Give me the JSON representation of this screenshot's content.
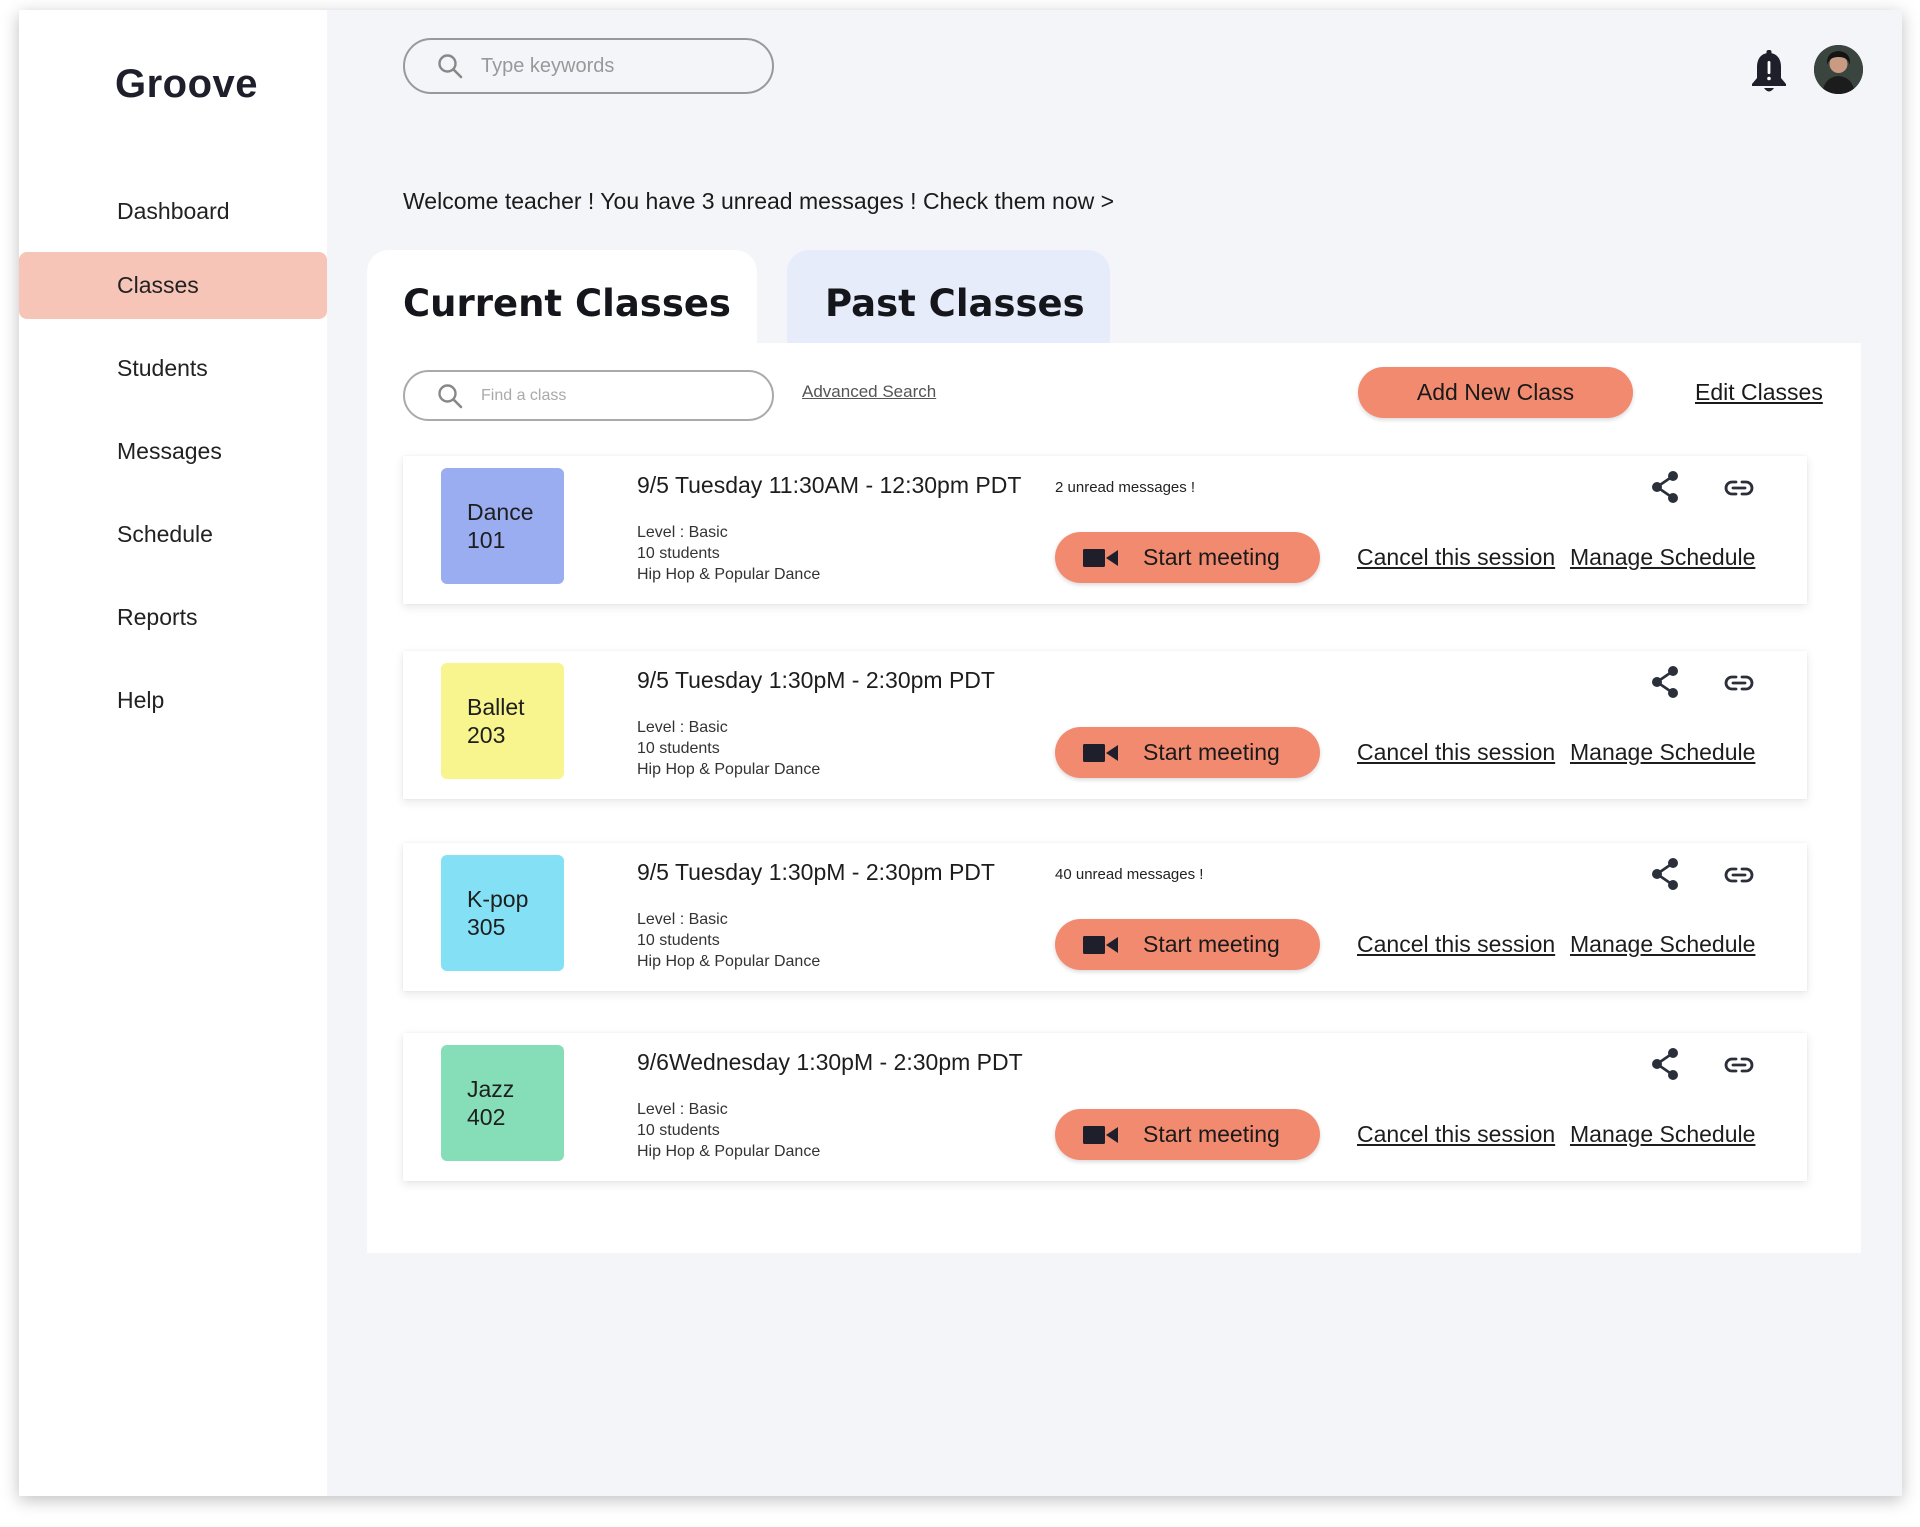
{
  "app": {
    "logo": "Groove"
  },
  "sidebar": {
    "items": [
      {
        "label": "Dashboard"
      },
      {
        "label": "Classes"
      },
      {
        "label": "Students"
      },
      {
        "label": "Messages"
      },
      {
        "label": "Schedule"
      },
      {
        "label": "Reports"
      },
      {
        "label": "Help"
      }
    ],
    "active": "Classes"
  },
  "header": {
    "search_placeholder": "Type keywords",
    "bell_icon": "bell-icon",
    "avatar": "user-avatar"
  },
  "welcome": "Welcome teacher ! You have 3 unread messages ! Check them now >",
  "tabs": [
    {
      "label": "Current Classes"
    },
    {
      "label": "Past Classes"
    }
  ],
  "toolbar": {
    "find_placeholder": "Find a class",
    "advanced_search": "Advanced Search",
    "add_new_class": "Add New Class",
    "edit_classes": "Edit Classes"
  },
  "actions": {
    "start_meeting": "Start meeting",
    "cancel_session": "Cancel this session",
    "manage_schedule": "Manage Schedule"
  },
  "colors": {
    "accent": "#f28a70",
    "active_nav": "#f7c4b8",
    "past_tab": "#e6ecfa"
  },
  "classes": [
    {
      "name_line1": "Dance",
      "name_line2": "101",
      "color": "#9aadf0",
      "time": "9/5 Tuesday 11:30AM - 12:30pm PDT",
      "unread": "2 unread messages !",
      "level": "Level : Basic",
      "students": "10 students",
      "genre": "Hip Hop  & Popular Dance"
    },
    {
      "name_line1": "Ballet",
      "name_line2": "203",
      "color": "#f8f48e",
      "time": "9/5 Tuesday  1:30pM - 2:30pm PDT",
      "unread": "",
      "level": "Level : Basic",
      "students": "10 students",
      "genre": "Hip Hop  & Popular Dance"
    },
    {
      "name_line1": "K-pop",
      "name_line2": "305",
      "color": "#83e0f5",
      "time": "9/5 Tuesday  1:30pM - 2:30pm PDT",
      "unread": "40 unread messages !",
      "level": "Level : Basic",
      "students": "10 students",
      "genre": "Hip Hop  & Popular Dance"
    },
    {
      "name_line1": "Jazz",
      "name_line2": "402",
      "color": "#85deb8",
      "time": "9/6Wednesday  1:30pM - 2:30pm PDT",
      "unread": "",
      "level": "Level : Basic",
      "students": "10 students",
      "genre": "Hip Hop  & Popular Dance"
    }
  ]
}
